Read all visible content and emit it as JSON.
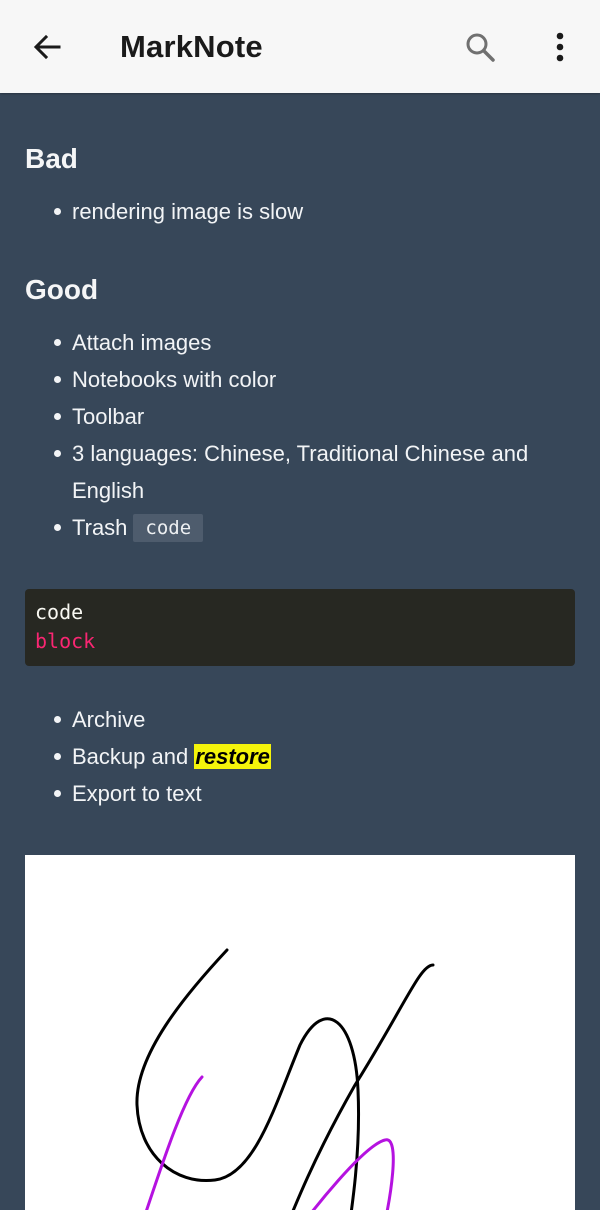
{
  "appbar": {
    "title": "MarkNote",
    "back_icon": "arrow-back-icon",
    "search_icon": "search-icon",
    "more_icon": "more-vert-icon"
  },
  "note": {
    "sections": [
      {
        "heading": "Bad",
        "items": [
          "rendering image is slow"
        ]
      },
      {
        "heading": "Good",
        "items": [
          "Attach images",
          "Notebooks with color",
          "Toolbar",
          "3 languages: Chinese, Traditional Chinese and English",
          "Trash"
        ]
      }
    ],
    "inline_code": "code",
    "code_block": {
      "line1": "code",
      "line2": "block"
    },
    "list2": {
      "archive": "Archive",
      "backup_prefix": "Backup and ",
      "backup_highlight": "restore",
      "export": "Export to text"
    }
  },
  "colors": {
    "background": "#374759",
    "appbar": "#f7f7f7",
    "highlight": "#f4f40b",
    "code_keyword": "#f92672"
  }
}
